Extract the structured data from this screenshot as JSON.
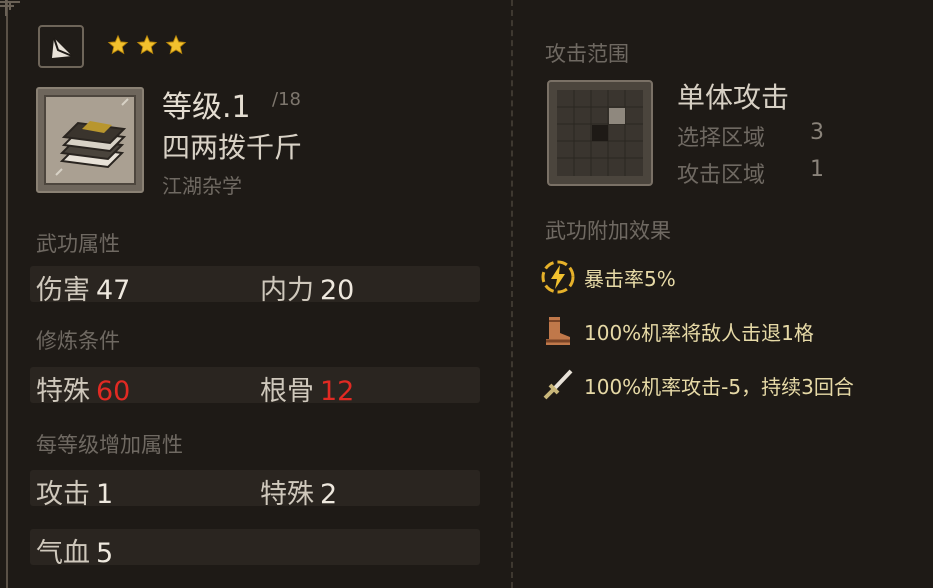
{
  "stars": 3,
  "skill": {
    "level_text": "等级.1",
    "level_max": "/18",
    "name": "四两拨千斤",
    "category": "江湖杂学"
  },
  "attributes": {
    "title": "武功属性",
    "damage_label": "伤害",
    "damage_value": "47",
    "inner_label": "内力",
    "inner_value": "20"
  },
  "requirements": {
    "title": "修炼条件",
    "special_label": "特殊",
    "special_value": "60",
    "bone_label": "根骨",
    "bone_value": "12"
  },
  "per_level": {
    "title": "每等级增加属性",
    "attack_label": "攻击",
    "attack_value": "1",
    "special_label": "特殊",
    "special_value": "2",
    "hp_label": "气血",
    "hp_value": "5"
  },
  "range": {
    "title": "攻击范围",
    "type": "单体攻击",
    "select_label": "选择区域",
    "select_value": "3",
    "attack_label": "攻击区域",
    "attack_value": "1"
  },
  "effects": {
    "title": "武功附加效果",
    "items": [
      {
        "icon": "lightning-icon",
        "text": "暴击率5%"
      },
      {
        "icon": "boot-icon",
        "text": "100%机率将敌人击退1格"
      },
      {
        "icon": "sword-icon",
        "text": "100%机率攻击-5，持续3回合"
      }
    ]
  },
  "colors": {
    "requirement_unmet": "#e12a23",
    "effect_text": "#e6d9a6",
    "star": "#f2c12e"
  }
}
